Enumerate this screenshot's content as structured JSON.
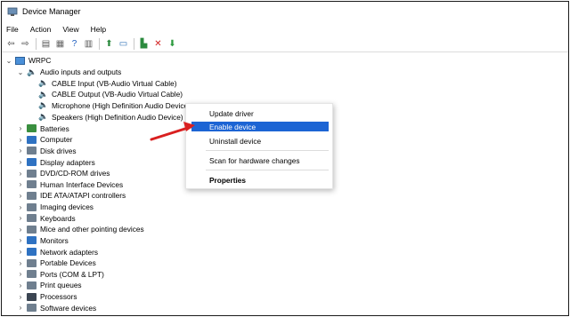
{
  "window": {
    "title": "Device Manager",
    "icon": "device-manager-icon"
  },
  "menu": [
    "File",
    "Action",
    "View",
    "Help"
  ],
  "toolbar": [
    {
      "name": "back-icon",
      "glyph": "⇦",
      "color": "#3a3a3a"
    },
    {
      "name": "forward-icon",
      "glyph": "⇨",
      "color": "#3a3a3a"
    },
    {
      "name": "properties-icon",
      "glyph": "▤",
      "color": "#555"
    },
    {
      "name": "console-tree-icon",
      "glyph": "▦",
      "color": "#666"
    },
    {
      "name": "help-icon",
      "glyph": "?",
      "color": "#1f5fbf"
    },
    {
      "name": "action-pane-icon",
      "glyph": "▥",
      "color": "#555"
    },
    {
      "name": "update-driver-icon",
      "glyph": "⬆",
      "color": "#2b8a3e"
    },
    {
      "name": "scan-hardware-icon",
      "glyph": "▭",
      "color": "#2a6db5"
    },
    {
      "name": "enable-device-icon",
      "glyph": "▙",
      "color": "#2b8a3e"
    },
    {
      "name": "uninstall-device-icon",
      "glyph": "✕",
      "color": "#d11e1e"
    },
    {
      "name": "download-driver-icon",
      "glyph": "⬇",
      "color": "#2b9a3e"
    }
  ],
  "tree": {
    "root": "WRPC",
    "audio_group": "Audio inputs and outputs",
    "audio_items": [
      "CABLE Input (VB-Audio Virtual Cable)",
      "CABLE Output (VB-Audio Virtual Cable)",
      "Microphone (High Definition Audio Device)",
      "Speakers (High Definition Audio Device)"
    ],
    "categories": [
      "Batteries",
      "Computer",
      "Disk drives",
      "Display adapters",
      "DVD/CD-ROM drives",
      "Human Interface Devices",
      "IDE ATA/ATAPI controllers",
      "Imaging devices",
      "Keyboards",
      "Mice and other pointing devices",
      "Monitors",
      "Network adapters",
      "Portable Devices",
      "Ports (COM & LPT)",
      "Print queues",
      "Processors",
      "Software devices"
    ]
  },
  "context_menu": {
    "update_driver": "Update driver",
    "enable_device": "Enable device",
    "uninstall_device": "Uninstall device",
    "scan_hardware": "Scan for hardware changes",
    "properties": "Properties"
  },
  "colors": {
    "highlight": "#1c64d4",
    "arrow": "#d91f1f"
  }
}
